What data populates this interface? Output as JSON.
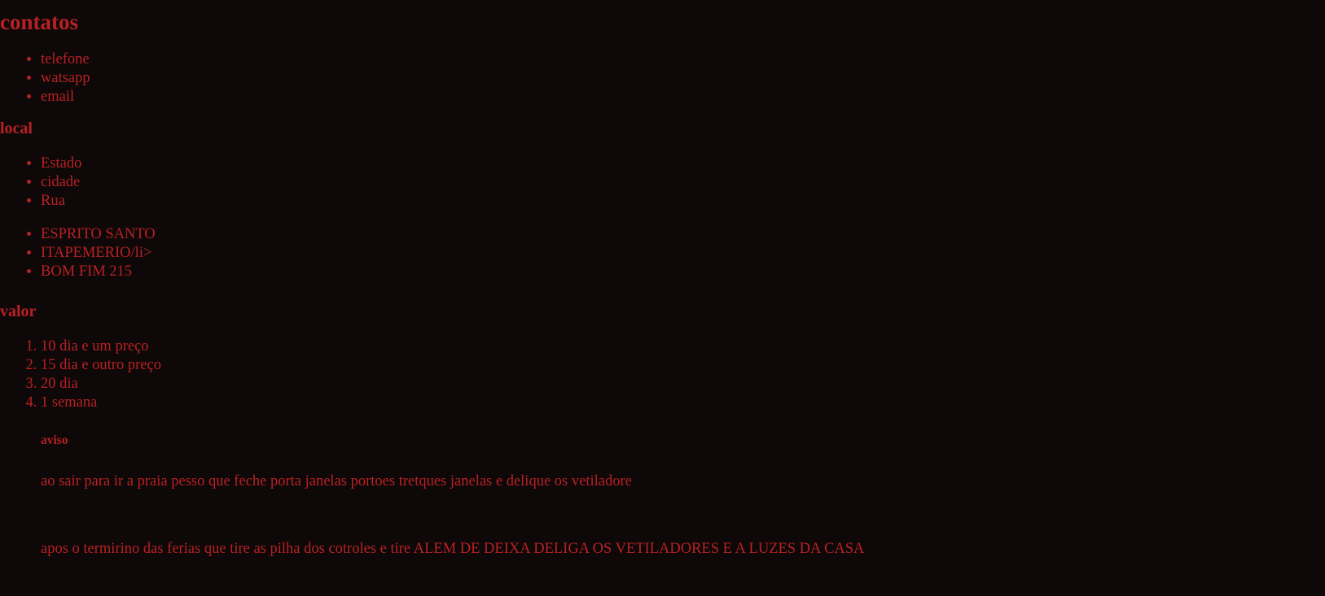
{
  "contatos": {
    "title": "contatos",
    "items": [
      "telefone",
      "watsapp",
      "email"
    ]
  },
  "local": {
    "title": "local",
    "labels": [
      "Estado",
      "cidade",
      "Rua"
    ],
    "values": [
      "ESPRITO SANTO",
      "ITAPEMERIO/li>",
      "BOM FIM 215"
    ]
  },
  "valor": {
    "title": "valor",
    "items": [
      "10 dia e um preço",
      "15 dia e outro preço",
      "20 dia",
      "1 semana"
    ]
  },
  "aviso": {
    "title": "aviso",
    "paragraph1": "ao sair para ir a praia pesso que feche porta janelas portoes tretques janelas e delique os vetiladore",
    "paragraph2": "apos o termirino das ferias que tire as pilha dos cotroles e tire ALEM DE DEIXA DELIGA OS VETILADORES E A LUZES DA CASA"
  },
  "colors": {
    "background": "#0e0808",
    "text": "#b82124"
  }
}
